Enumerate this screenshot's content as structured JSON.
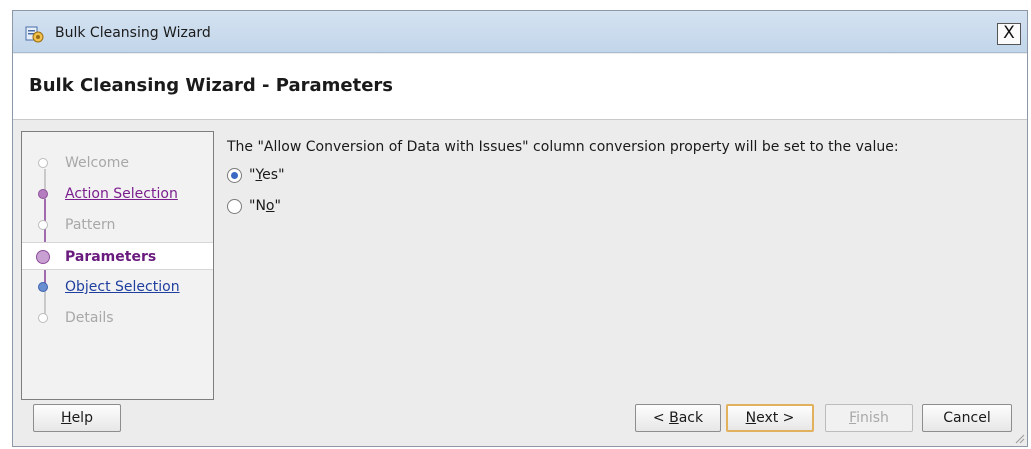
{
  "window": {
    "title": "Bulk Cleansing Wizard",
    "close_label": "X"
  },
  "header": {
    "title": "Bulk Cleansing Wizard - Parameters"
  },
  "steps": [
    {
      "label": "Welcome",
      "state": "disabled"
    },
    {
      "label": "Action Selection",
      "state": "visited"
    },
    {
      "label": "Pattern",
      "state": "disabled"
    },
    {
      "label": "Parameters",
      "state": "current"
    },
    {
      "label": "Object Selection",
      "state": "link"
    },
    {
      "label": "Details",
      "state": "disabled"
    }
  ],
  "content": {
    "description": "The \"Allow Conversion of Data with Issues\" column conversion property will be set to the value:",
    "options": [
      {
        "label_pre": "\"",
        "mnemonic": "Y",
        "label_post": "es\"",
        "checked": true
      },
      {
        "label_pre": "\"N",
        "mnemonic": "o",
        "label_post": "\"",
        "checked": false
      }
    ]
  },
  "buttons": {
    "help": {
      "mnemonic": "H",
      "rest": "elp"
    },
    "back": {
      "pre": "< ",
      "mnemonic": "B",
      "rest": "ack"
    },
    "next": {
      "mnemonic": "N",
      "rest": "ext >"
    },
    "finish": {
      "mnemonic": "F",
      "rest": "inish"
    },
    "cancel": {
      "label": "Cancel"
    }
  },
  "colors": {
    "titlebar": "#c8daec",
    "visited_link": "#7b1f8e",
    "link": "#1f3f9e",
    "default_button_border": "#e2b15e"
  }
}
